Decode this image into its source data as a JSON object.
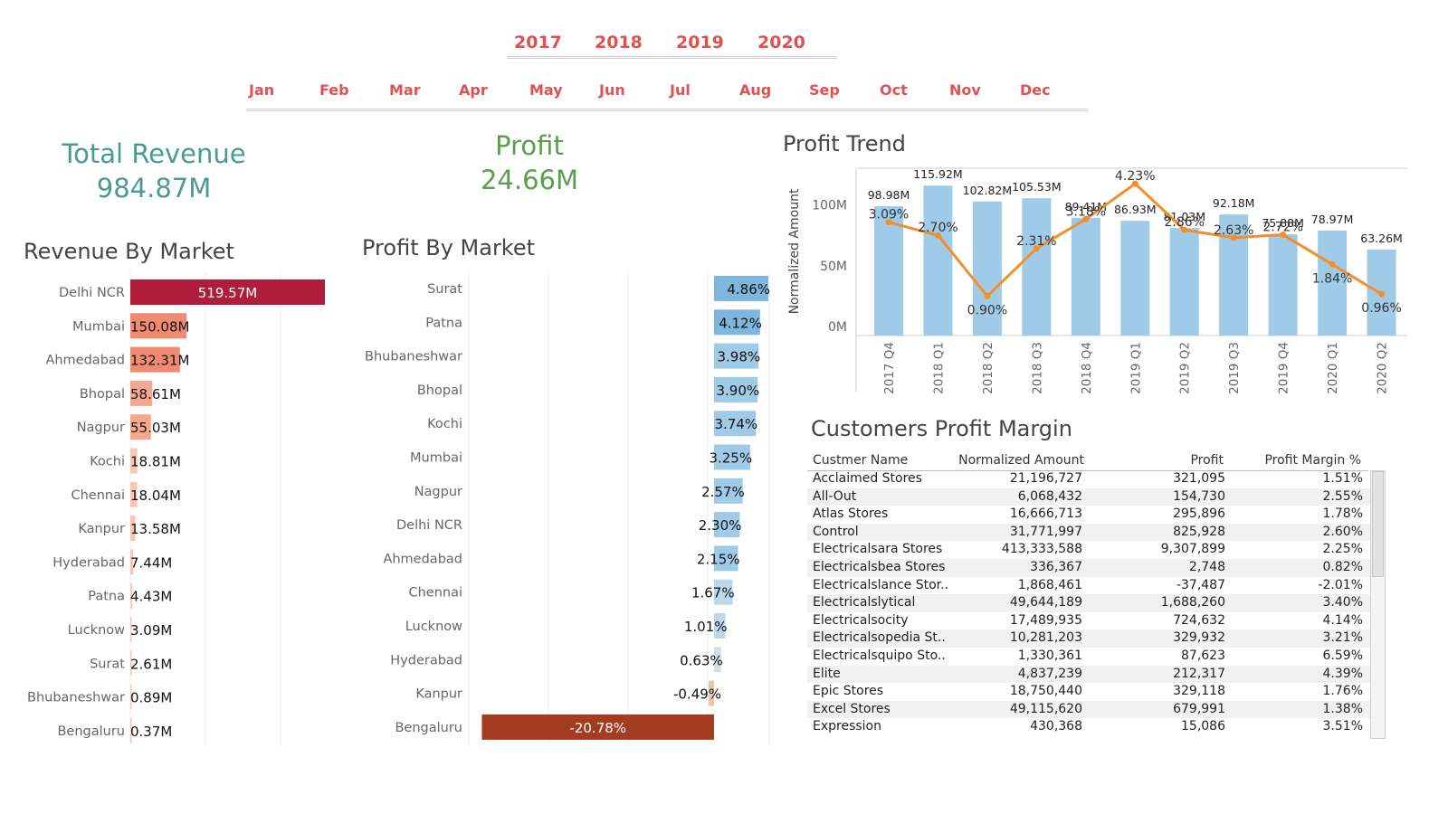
{
  "filters": {
    "years": [
      "2017",
      "2018",
      "2019",
      "2020"
    ],
    "months": [
      "Jan",
      "Feb",
      "Mar",
      "Apr",
      "May",
      "Jun",
      "Jul",
      "Aug",
      "Sep",
      "Oct",
      "Nov",
      "Dec"
    ]
  },
  "kpis": {
    "revenue_title": "Total Revenue",
    "revenue_value": "984.87M",
    "profit_title": "Profit",
    "profit_value": "24.66M"
  },
  "colors": {
    "accent_red": "#e05252",
    "revenue_teal": "#4a9a94",
    "profit_green": "#5aa04c",
    "bar_blue": "#9fcbe8",
    "line_orange": "#f28e2b",
    "negative_brown": "#a33d22",
    "top_market": "#b01c3c"
  },
  "chart_data": [
    {
      "type": "bar",
      "title": "Revenue By Market",
      "categories": [
        "Delhi NCR",
        "Mumbai",
        "Ahmedabad",
        "Bhopal",
        "Nagpur",
        "Kochi",
        "Chennai",
        "Kanpur",
        "Hyderabad",
        "Patna",
        "Lucknow",
        "Surat",
        "Bhubaneshwar",
        "Bengaluru"
      ],
      "values": [
        519.57,
        150.08,
        132.31,
        58.61,
        55.03,
        18.81,
        18.04,
        13.58,
        7.44,
        4.43,
        3.09,
        2.61,
        0.89,
        0.37
      ],
      "labels": [
        "519.57M",
        "150.08M",
        "132.31M",
        "58.61M",
        "55.03M",
        "18.81M",
        "18.04M",
        "13.58M",
        "7.44M",
        "4.43M",
        "3.09M",
        "2.61M",
        "0.89M",
        "0.37M"
      ],
      "orientation": "horizontal",
      "xlim": [
        0,
        540
      ],
      "grid": true
    },
    {
      "type": "bar",
      "title": "Profit By Market",
      "categories": [
        "Surat",
        "Patna",
        "Bhubaneshwar",
        "Bhopal",
        "Kochi",
        "Mumbai",
        "Nagpur",
        "Delhi NCR",
        "Ahmedabad",
        "Chennai",
        "Lucknow",
        "Hyderabad",
        "Kanpur",
        "Bengaluru"
      ],
      "values": [
        4.86,
        4.12,
        3.98,
        3.9,
        3.74,
        3.25,
        2.57,
        2.3,
        2.15,
        1.67,
        1.01,
        0.63,
        -0.49,
        -20.78
      ],
      "labels": [
        "4.86%",
        "4.12%",
        "3.98%",
        "3.90%",
        "3.74%",
        "3.25%",
        "2.57%",
        "2.30%",
        "2.15%",
        "1.67%",
        "1.01%",
        "0.63%",
        "-0.49%",
        "-20.78%"
      ],
      "orientation": "horizontal",
      "xlim": [
        -21,
        5
      ],
      "grid": true
    },
    {
      "type": "bar",
      "title": "Profit Trend",
      "ylabel": "Normalized Amount",
      "categories": [
        "2017 Q4",
        "2018 Q1",
        "2018 Q2",
        "2018 Q3",
        "2018 Q4",
        "2019 Q1",
        "2019 Q2",
        "2019 Q3",
        "2019 Q4",
        "2020 Q1",
        "2020 Q2"
      ],
      "series": [
        {
          "values": [
            98.98,
            115.92,
            102.82,
            105.53,
            89.41,
            86.93,
            81.03,
            92.18,
            75.88,
            78.97,
            63.26
          ],
          "labels": [
            "98.98M",
            "115.92M",
            "102.82M",
            "105.53M",
            "89.41M",
            "86.93M",
            "81.03M",
            "92.18M",
            "75.88M",
            "78.97M",
            "63.26M"
          ]
        },
        {
          "values": [
            3.09,
            2.7,
            0.9,
            2.31,
            3.18,
            4.23,
            2.86,
            2.63,
            2.72,
            1.84,
            0.96
          ],
          "labels": [
            "3.09%",
            "2.70%",
            "0.90%",
            "2.31%",
            "3.18%",
            "4.23%",
            "2.86%",
            "2.63%",
            "2.72%",
            "1.84%",
            "0.96%"
          ],
          "type": "line"
        }
      ],
      "yticks": [
        "0M",
        "50M",
        "100M"
      ],
      "ylim": [
        0,
        125
      ],
      "y2lim": [
        0,
        4.5
      ],
      "grid": false
    }
  ],
  "table": {
    "title": "Customers Profit Margin",
    "columns": [
      "Custmer Name",
      "Normalized Amount",
      "Profit",
      "Profit Margin %"
    ],
    "rows": [
      [
        "Acclaimed Stores",
        "21,196,727",
        "321,095",
        "1.51%"
      ],
      [
        "All-Out",
        "6,068,432",
        "154,730",
        "2.55%"
      ],
      [
        "Atlas Stores",
        "16,666,713",
        "295,896",
        "1.78%"
      ],
      [
        "Control",
        "31,771,997",
        "825,928",
        "2.60%"
      ],
      [
        "Electricalsara Stores",
        "413,333,588",
        "9,307,899",
        "2.25%"
      ],
      [
        "Electricalsbea Stores",
        "336,367",
        "2,748",
        "0.82%"
      ],
      [
        "Electricalslance Stor..",
        "1,868,461",
        "-37,487",
        "-2.01%"
      ],
      [
        "Electricalslytical",
        "49,644,189",
        "1,688,260",
        "3.40%"
      ],
      [
        "Electricalsocity",
        "17,489,935",
        "724,632",
        "4.14%"
      ],
      [
        "Electricalsopedia St..",
        "10,281,203",
        "329,932",
        "3.21%"
      ],
      [
        "Electricalsquipo Sto..",
        "1,330,361",
        "87,623",
        "6.59%"
      ],
      [
        "Elite",
        "4,837,239",
        "212,317",
        "4.39%"
      ],
      [
        "Epic Stores",
        "18,750,440",
        "329,118",
        "1.76%"
      ],
      [
        "Excel Stores",
        "49,115,620",
        "679,991",
        "1.38%"
      ],
      [
        "Expression",
        "430,368",
        "15,086",
        "3.51%"
      ]
    ]
  }
}
